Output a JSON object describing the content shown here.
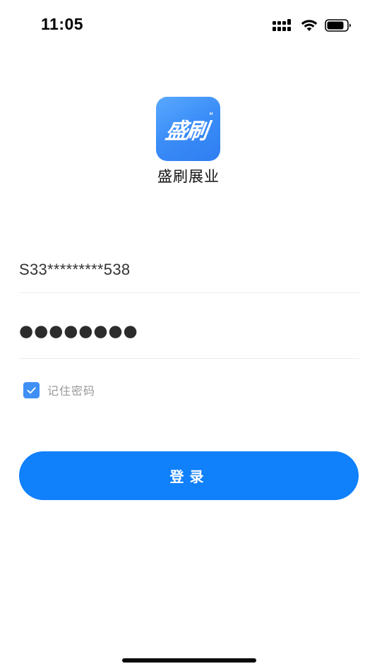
{
  "status_bar": {
    "time": "11:05",
    "icons": [
      "signal-icon",
      "wifi-icon",
      "battery-icon"
    ]
  },
  "app": {
    "logo_text": "盛刷",
    "logo_mark": "\"",
    "name": "盛刷展业",
    "accent_color": "#1080fb"
  },
  "login_form": {
    "account_value": "S33*********538",
    "password_value": "●●●●●●●●",
    "remember_label": "记住密码",
    "remember_checked": true,
    "login_label": "登录"
  }
}
